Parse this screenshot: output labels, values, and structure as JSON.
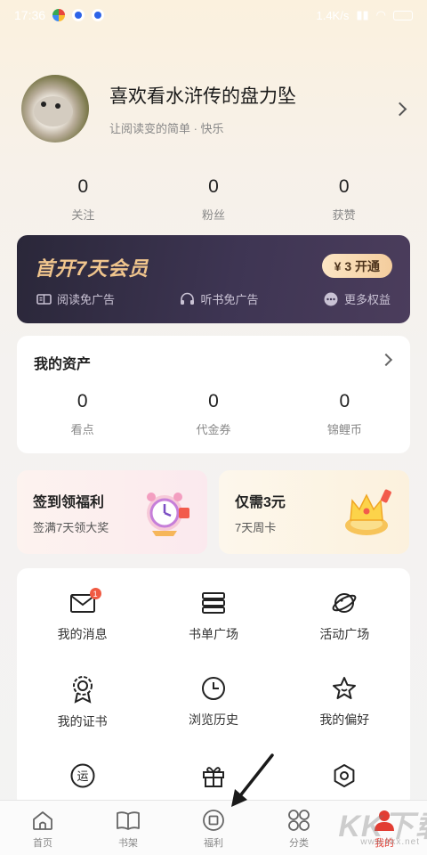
{
  "status_bar": {
    "time": "17:36",
    "speed": "1.4K/s",
    "battery": ""
  },
  "profile": {
    "name": "喜欢看水浒传的盘力坠",
    "subtitle": "让阅读变的简单 · 快乐"
  },
  "social_stats": [
    {
      "value": "0",
      "label": "关注"
    },
    {
      "value": "0",
      "label": "粉丝"
    },
    {
      "value": "0",
      "label": "获赞"
    }
  ],
  "vip": {
    "title": "首开7天会员",
    "button": "¥ 3 开通",
    "perks": [
      "阅读免广告",
      "听书免广告",
      "更多权益"
    ]
  },
  "assets": {
    "title": "我的资产",
    "items": [
      {
        "value": "0",
        "label": "看点"
      },
      {
        "value": "0",
        "label": "代金券"
      },
      {
        "value": "0",
        "label": "锦鲤币"
      }
    ]
  },
  "promos": [
    {
      "title": "签到领福利",
      "subtitle": "签满7天领大奖"
    },
    {
      "title": "仅需3元",
      "subtitle": "7天周卡"
    }
  ],
  "menu": {
    "items": [
      {
        "label": "我的消息",
        "icon": "mail-icon",
        "badge": "1"
      },
      {
        "label": "书单广场",
        "icon": "list-stack-icon"
      },
      {
        "label": "活动广场",
        "icon": "planet-icon"
      },
      {
        "label": "我的证书",
        "icon": "medal-icon"
      },
      {
        "label": "浏览历史",
        "icon": "clock-icon"
      },
      {
        "label": "我的偏好",
        "icon": "star-icon"
      },
      {
        "label": "",
        "icon": "yun-icon"
      },
      {
        "label": "",
        "icon": "gift-icon"
      },
      {
        "label": "",
        "icon": "settings-hex-icon"
      }
    ]
  },
  "tabbar": [
    {
      "label": "首页",
      "icon": "home-icon"
    },
    {
      "label": "书架",
      "icon": "book-icon"
    },
    {
      "label": "福利",
      "icon": "welfare-icon"
    },
    {
      "label": "分类",
      "icon": "grid-icon"
    },
    {
      "label": "我的",
      "icon": "person-icon",
      "active": true
    }
  ],
  "watermark": {
    "text": "KK下载",
    "url": "www.kkx.net"
  },
  "colors": {
    "accent": "#e23d33",
    "vip_gold": "#f0c58d",
    "vip_bg": "#2a2739"
  }
}
